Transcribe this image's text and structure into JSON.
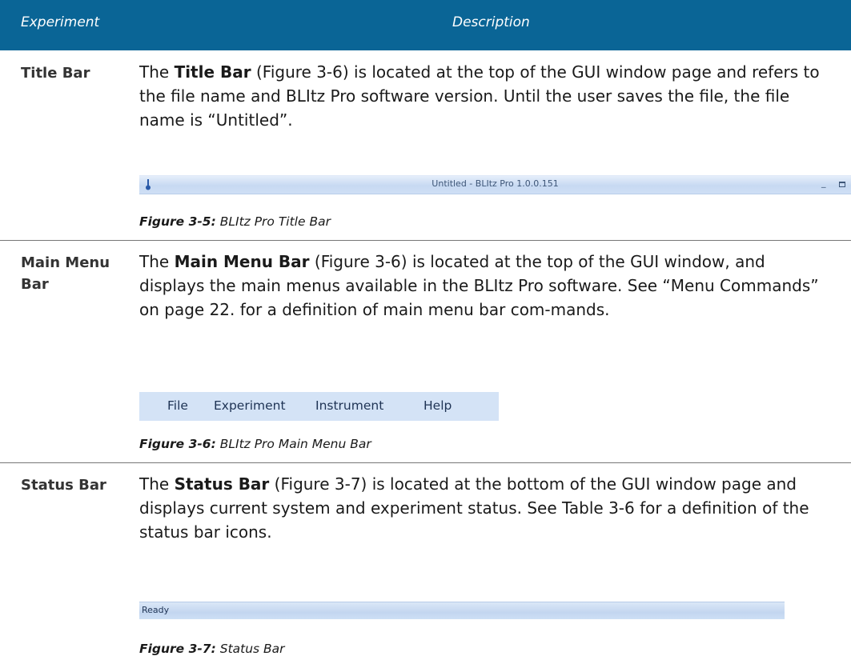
{
  "table_header": {
    "col_experiment": "Experiment",
    "col_description": "Description"
  },
  "rows": [
    {
      "label": "Title Bar",
      "desc_pre": "The ",
      "desc_bold": "Title Bar",
      "desc_post": " (Figure 3-6) is located at the top of the GUI window page and refers to the file name and BLItz Pro software version. Until the user saves the file, the file name is “Untitled”.",
      "caption_label": "Figure 3-5:",
      "caption_text": " BLItz Pro Title Bar"
    },
    {
      "label": "Main Menu Bar",
      "desc_pre": "The ",
      "desc_bold": "Main Menu Bar",
      "desc_post": " (Figure 3-6) is located at the top of the GUI window, and displays the main menus available in the BLItz Pro software. See “Menu Commands” on page 22. for a definition of main menu bar com-mands.",
      "caption_label": "Figure 3-6:",
      "caption_text": " BLItz Pro Main Menu Bar"
    },
    {
      "label": "Status Bar",
      "desc_pre": "The ",
      "desc_bold": "Status Bar",
      "desc_post": " (Figure 3-7) is located at the bottom of the GUI window page and displays current system and experiment status. See Table 3-6 for a definition of the status bar icons.",
      "caption_label": "Figure 3-7:",
      "caption_text": " Status Bar"
    }
  ],
  "figure_title_bar": {
    "title": "Untitled - BLItz Pro 1.0.0.151",
    "app_icon": "app-icon",
    "minimize_icon": "minimize-icon",
    "maximize_icon": "maximize-icon"
  },
  "figure_menu_bar": {
    "items": [
      "File",
      "Experiment",
      "Instrument",
      "Help"
    ]
  },
  "figure_status_bar": {
    "status": "Ready"
  },
  "colors": {
    "header_bg": "#0a6596",
    "header_text": "#ffffff",
    "menubar_bg": "#d4e3f6"
  }
}
